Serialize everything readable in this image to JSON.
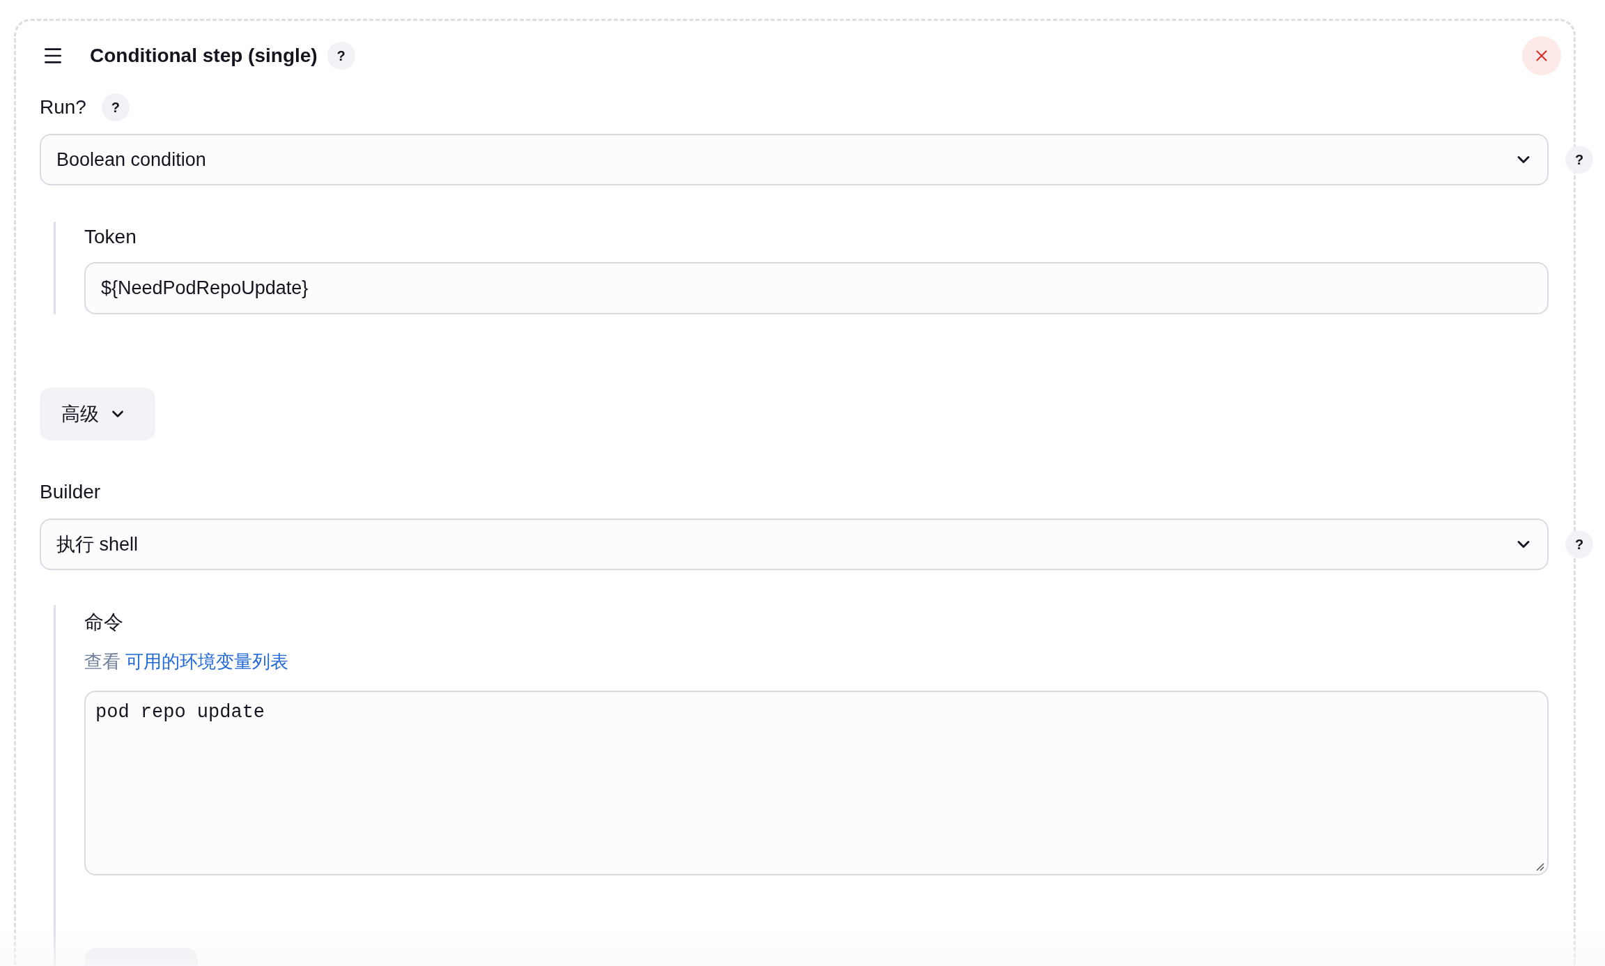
{
  "step": {
    "title": "Conditional step (single)",
    "help": "?"
  },
  "run": {
    "label": "Run?",
    "help": "?",
    "select": {
      "value": "Boolean condition"
    },
    "side_help": "?",
    "token": {
      "label": "Token",
      "value": "${NeedPodRepoUpdate}"
    }
  },
  "advanced_button": {
    "label": "高级"
  },
  "builder": {
    "label": "Builder",
    "select": {
      "value": "执行 shell"
    },
    "side_help": "?",
    "command": {
      "label": "命令",
      "hint_prefix": "查看",
      "hint_link": "可用的环境变量列表",
      "value": "pod repo update"
    }
  }
}
